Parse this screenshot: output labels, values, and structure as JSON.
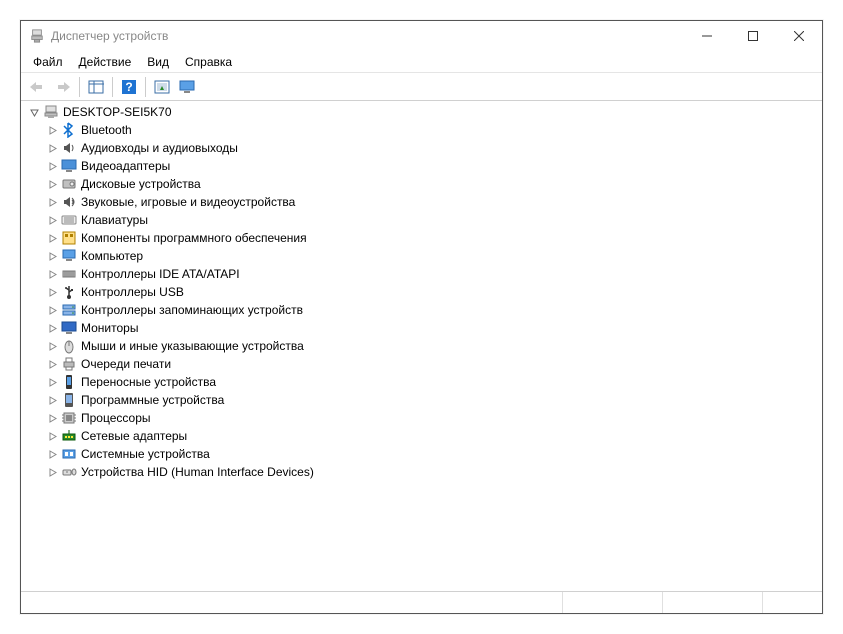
{
  "window": {
    "title": "Диспетчер устройств"
  },
  "menu": {
    "file": "Файл",
    "action": "Действие",
    "view": "Вид",
    "help": "Справка"
  },
  "tree": {
    "root": "DESKTOP-SEI5K70",
    "items": [
      {
        "label": "Bluetooth",
        "icon": "bluetooth"
      },
      {
        "label": "Аудиовходы и аудиовыходы",
        "icon": "audio"
      },
      {
        "label": "Видеоадаптеры",
        "icon": "display"
      },
      {
        "label": "Дисковые устройства",
        "icon": "disk"
      },
      {
        "label": "Звуковые, игровые и видеоустройства",
        "icon": "sound"
      },
      {
        "label": "Клавиатуры",
        "icon": "keyboard"
      },
      {
        "label": "Компоненты программного обеспечения",
        "icon": "software"
      },
      {
        "label": "Компьютер",
        "icon": "computer"
      },
      {
        "label": "Контроллеры IDE ATA/ATAPI",
        "icon": "ide"
      },
      {
        "label": "Контроллеры USB",
        "icon": "usb"
      },
      {
        "label": "Контроллеры запоминающих устройств",
        "icon": "storage"
      },
      {
        "label": "Мониторы",
        "icon": "monitor"
      },
      {
        "label": "Мыши и иные указывающие устройства",
        "icon": "mouse"
      },
      {
        "label": "Очереди печати",
        "icon": "printer"
      },
      {
        "label": "Переносные устройства",
        "icon": "portable"
      },
      {
        "label": "Программные устройства",
        "icon": "softdev"
      },
      {
        "label": "Процессоры",
        "icon": "cpu"
      },
      {
        "label": "Сетевые адаптеры",
        "icon": "network"
      },
      {
        "label": "Системные устройства",
        "icon": "system"
      },
      {
        "label": "Устройства HID (Human Interface Devices)",
        "icon": "hid"
      }
    ]
  }
}
